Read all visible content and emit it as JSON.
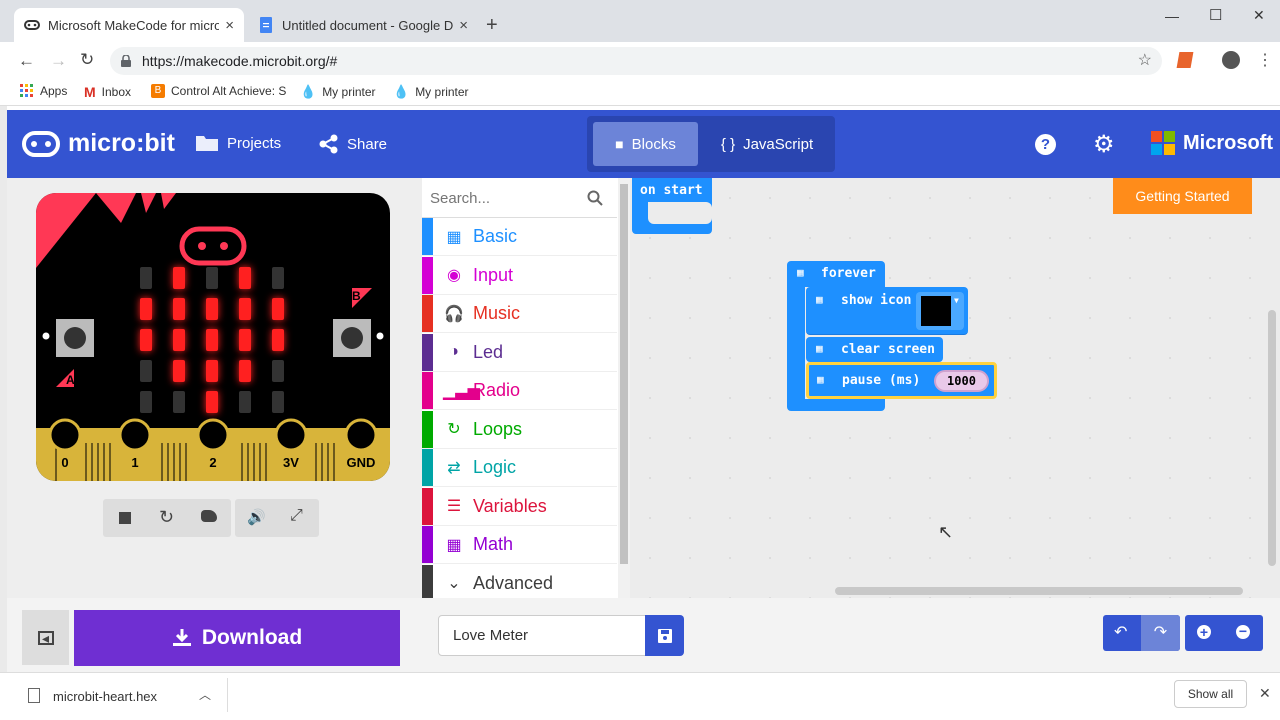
{
  "browser": {
    "tabs": [
      {
        "title": "Microsoft MakeCode for micro:bit",
        "close": "×"
      },
      {
        "title": "Untitled document - Google Doc",
        "close": "×"
      }
    ],
    "new_tab": "+",
    "window_controls": {
      "minimize": "—",
      "maximize": "☐",
      "close": "✕"
    },
    "url": "https://makecode.microbit.org/#",
    "bookmarks": [
      "Apps",
      "Inbox",
      "Control Alt Achieve: S",
      "My printer",
      "My printer"
    ]
  },
  "header": {
    "logo": "micro:bit",
    "projects": "Projects",
    "share": "Share",
    "blocks": "Blocks",
    "javascript": "JavaScript",
    "javascript_icon": "{ }",
    "microsoft": "Microsoft"
  },
  "simulator": {
    "pins": [
      "0",
      "1",
      "2",
      "3V",
      "GND"
    ],
    "button_a": "A",
    "button_b": "B",
    "leds": [
      [
        0,
        1,
        0,
        1,
        0
      ],
      [
        1,
        1,
        1,
        1,
        1
      ],
      [
        1,
        1,
        1,
        1,
        1
      ],
      [
        0,
        1,
        1,
        1,
        0
      ],
      [
        0,
        0,
        1,
        0,
        0
      ]
    ],
    "led_on_color": "#ff2020",
    "led_off_color": "#333333"
  },
  "toolbox": {
    "search_placeholder": "Search...",
    "categories": [
      {
        "label": "Basic",
        "color": "#1e90ff",
        "icon": "grid-icon"
      },
      {
        "label": "Input",
        "color": "#d400d4",
        "icon": "target-icon"
      },
      {
        "label": "Music",
        "color": "#e63022",
        "icon": "headphones-icon"
      },
      {
        "label": "Led",
        "color": "#5c2d91",
        "icon": "toggle-icon"
      },
      {
        "label": "Radio",
        "color": "#e3008c",
        "icon": "signal-icon"
      },
      {
        "label": "Loops",
        "color": "#00aa00",
        "icon": "loop-icon"
      },
      {
        "label": "Logic",
        "color": "#00a4a6",
        "icon": "shuffle-icon"
      },
      {
        "label": "Variables",
        "color": "#dc143c",
        "icon": "lines-icon"
      },
      {
        "label": "Math",
        "color": "#9400d3",
        "icon": "calculator-icon"
      },
      {
        "label": "Advanced",
        "color": "#3c3c3c",
        "icon": "chevron-down-icon"
      }
    ]
  },
  "workspace": {
    "getting_started": "Getting Started",
    "on_start": "on start",
    "forever": "forever",
    "show_icon": "show icon",
    "clear_screen": "clear screen",
    "pause": "pause (ms)",
    "pause_value": "1000",
    "block_color": "#1e90ff"
  },
  "bottom": {
    "download": "Download",
    "project_name": "Love Meter"
  },
  "downloads": {
    "file": "microbit-heart.hex",
    "show_all": "Show all"
  }
}
